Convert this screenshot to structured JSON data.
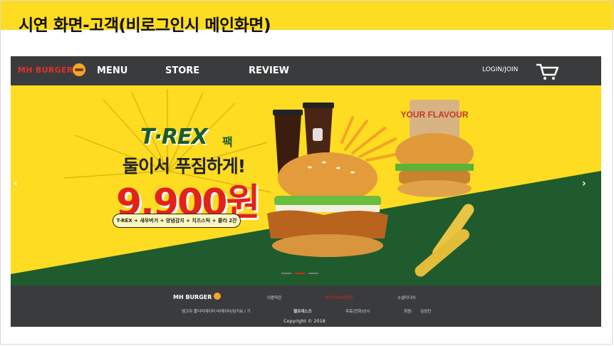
{
  "slide": {
    "title": "시연 화면-고객(비로그인시 메인화면)"
  },
  "header": {
    "logo": "MH BURGER",
    "nav": [
      "MENU",
      "STORE",
      "REVIEW"
    ],
    "login": "LOGIN/JOIN"
  },
  "hero": {
    "title_en": "T·REX",
    "title_ko": "팩",
    "subtitle": "둘이서 푸짐하게!",
    "price": "9,900원",
    "items": "T-REX + 새우버거 + 양념감자 + 치즈스틱 + 콜라 2잔",
    "cup_label": "YOUR FLAVOUR",
    "prev_arrow": "‹",
    "next_arrow": "›",
    "slide_count": 3,
    "active_slide": 2
  },
  "footer": {
    "logo": "MH BURGER",
    "links": [
      "이용약관",
      "개인정보처리방침",
      "소셜미디어"
    ],
    "info_1": "엠고아 플더미데이터 비데이터/임거보 / 기",
    "info_2": "헬프데스크",
    "info_3": "무료(전화)상시",
    "info_4": "회원:",
    "info_5": "김성진",
    "copyright": "Copyright © 2018"
  },
  "colors": {
    "title_band": "#fddc21",
    "header_bg": "#3a3b3d",
    "hero_yellow": "#fddc21",
    "hero_green": "#1f5b2c",
    "accent_red": "#e2231a"
  },
  "icons": [
    "burger-logo-icon",
    "cart-icon",
    "chevron-left-icon",
    "chevron-right-icon"
  ]
}
